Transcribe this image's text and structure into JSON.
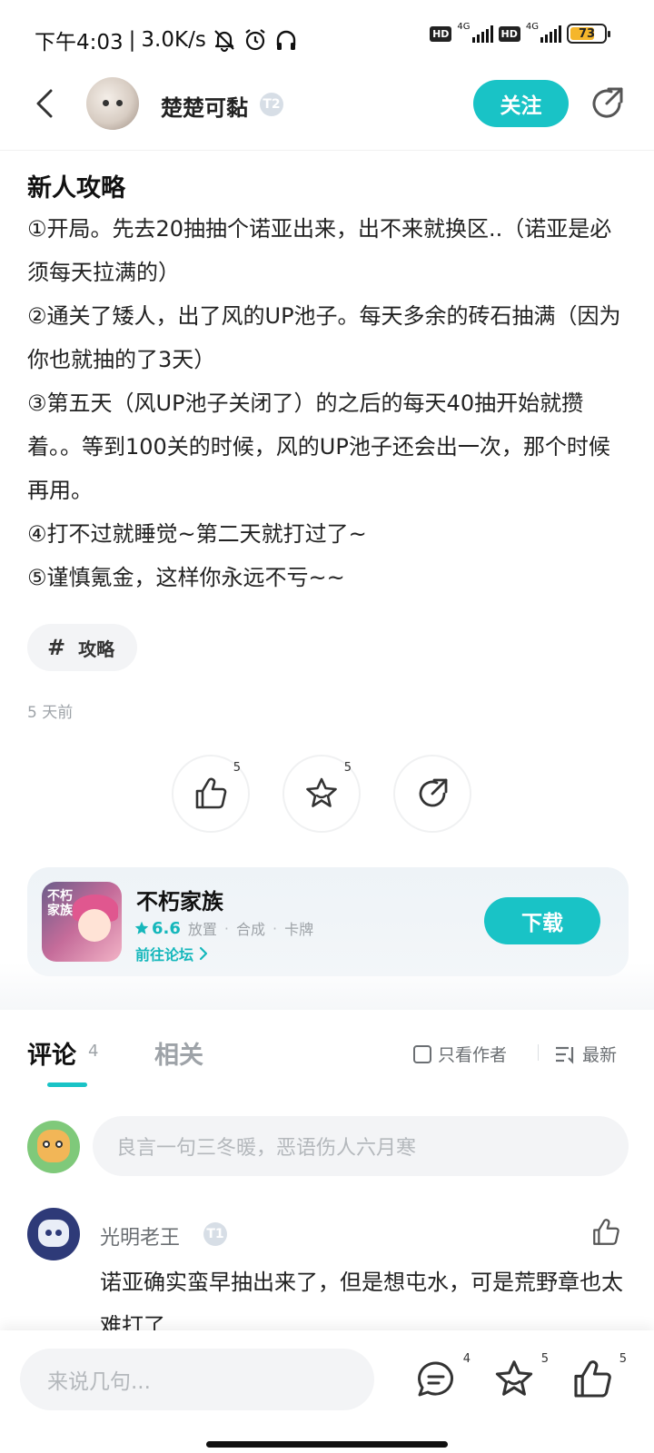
{
  "status_bar": {
    "time": "下午4:03",
    "separator": "|",
    "speed": "3.0K/s",
    "hd_label_1": "HD",
    "hd_label_2": "HD",
    "network_1": "4G",
    "network_2": "4G",
    "battery": "73",
    "battery_level": 0.73,
    "icons": [
      "mute-bell-icon",
      "alarm-icon",
      "headphones-icon",
      "signal-icon",
      "battery-icon"
    ]
  },
  "header": {
    "author_name": "楚楚可黏",
    "author_level": "T2",
    "follow_label": "关注",
    "icons": [
      "back-arrow-icon",
      "share-icon"
    ]
  },
  "post": {
    "title": "新人攻略",
    "paragraphs": [
      "①开局。先去20抽抽个诺亚出来，出不来就换区..（诺亚是必须每天拉满的）",
      "②通关了矮人，出了风的UP池子。每天多余的砖石抽满（因为你也就抽的了3天）",
      "③第五天（风UP池子关闭了）的之后的每天40抽开始就攒着。。等到100关的时候，风的UP池子还会出一次，那个时候再用。",
      "④打不过就睡觉~第二天就打过了~",
      "⑤谨慎氪金，这样你永远不亏~~"
    ],
    "tag_hash": "#",
    "tag": "攻略",
    "time_ago": "5 天前"
  },
  "actions": {
    "like_count": "5",
    "favorite_count": "5",
    "icons": [
      "thumbs-up-icon",
      "star-icon",
      "share-icon"
    ]
  },
  "game": {
    "name": "不朽家族",
    "rating": "6.6",
    "tags": [
      "放置",
      "合成",
      "卡牌"
    ],
    "dot": "·",
    "forum_link": "前往论坛",
    "download_label": "下载",
    "icon_text": "不朽家族"
  },
  "comments_section": {
    "tab_comments": "评论",
    "comments_count": "4",
    "tab_related": "相关",
    "author_only_label": "只看作者",
    "sort_label": "最新",
    "input_placeholder": "良言一句三冬暖，恶语伤人六月寒",
    "comments": [
      {
        "user": "光明老王",
        "level": "T1",
        "text": "诺亚确实蛮早抽出来了，但是想屯水，可是荒野章也太难打了"
      }
    ]
  },
  "bottom_bar": {
    "input_placeholder": "来说几句...",
    "comment_count": "4",
    "favorite_count": "5",
    "like_count": "5"
  },
  "colors": {
    "accent": "#19c3c6",
    "accent_dark": "#15b7bb",
    "muted": "#9ea3a8",
    "battery": "#f5b62b"
  }
}
